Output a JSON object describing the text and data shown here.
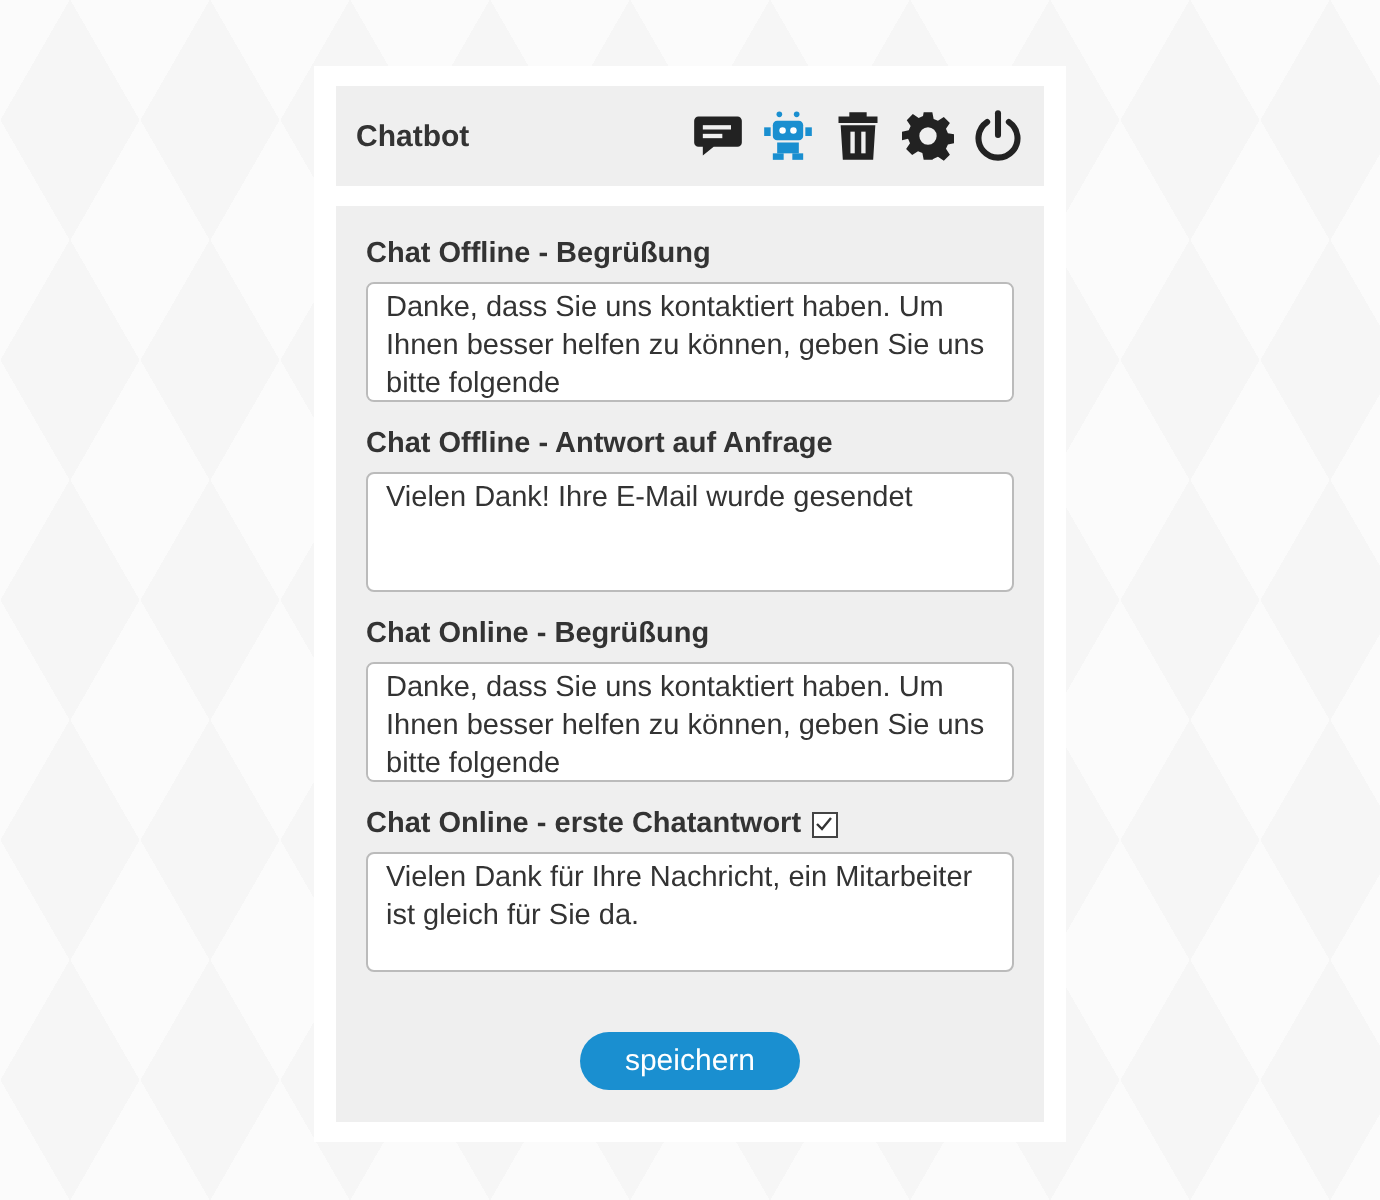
{
  "header": {
    "title": "Chatbot",
    "tools": [
      {
        "kind": "chat",
        "selected": false
      },
      {
        "kind": "robot",
        "selected": true
      },
      {
        "kind": "trash",
        "selected": false
      },
      {
        "kind": "settings",
        "selected": false
      },
      {
        "kind": "power",
        "selected": false
      }
    ]
  },
  "fields": [
    {
      "label": "Chat Offline - Begrüßung",
      "value": "Danke, dass Sie uns kontaktiert haben. Um Ihnen besser helfen zu können, geben Sie uns bitte folgende"
    },
    {
      "label": "Chat Offline - Antwort auf Anfrage",
      "value": "Vielen Dank! Ihre E-Mail wurde gesendet"
    },
    {
      "label": "Chat Online - Begrüßung",
      "value": "Danke, dass Sie uns kontaktiert haben. Um Ihnen besser helfen zu können, geben Sie uns bitte folgende"
    },
    {
      "label": "Chat Online - erste Chatantwort",
      "checked": true,
      "value": "Vielen Dank für Ihre Nachricht, ein Mitarbeiter ist gleich für Sie da."
    }
  ],
  "save_button": "speichern"
}
